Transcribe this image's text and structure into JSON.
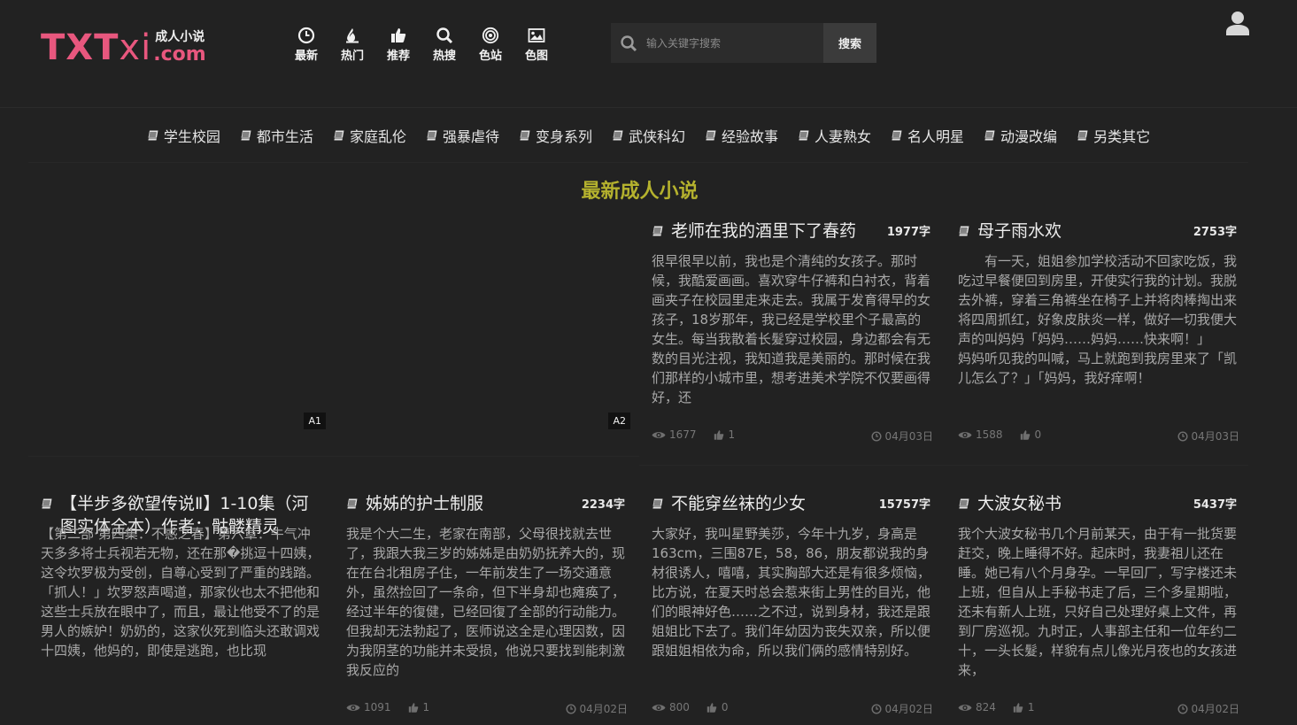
{
  "logo": {
    "part1": "TXT",
    "part2": "xi",
    "cn": "成人小说",
    "dotcom": ".com"
  },
  "topnav": [
    {
      "label": "最新",
      "icon": "clock-icon"
    },
    {
      "label": "热门",
      "icon": "flame-icon"
    },
    {
      "label": "推荐",
      "icon": "thumbs-up-icon"
    },
    {
      "label": "热搜",
      "icon": "search-icon"
    },
    {
      "label": "色站",
      "icon": "target-icon"
    },
    {
      "label": "色图",
      "icon": "image-icon"
    }
  ],
  "search": {
    "placeholder": "输入关键字搜索",
    "button": "搜索"
  },
  "categories": [
    "学生校园",
    "都市生活",
    "家庭乱伦",
    "强暴虐待",
    "变身系列",
    "武侠科幻",
    "经验故事",
    "人妻熟女",
    "名人明星",
    "动漫改编",
    "另类其它"
  ],
  "section_title": "最新成人小说",
  "ads": [
    "A1",
    "A2"
  ],
  "cards": [
    {
      "title": "老师在我的酒里下了春药",
      "words": "1977字",
      "excerpt": "很早很早以前，我也是个清纯的女孩子。那时候，我酷爱画画。喜欢穿牛仔裤和白衬衣，背着画夹子在校园里走来走去。我属于发育得早的女孩子，18岁那年，我已经是学校里个子最高的女生。每当我散着长髮穿过校园，身边都会有无数的目光注视，我知道我是美丽的。那时候在我们那样的小城市里，想考进美术学院不仅要画得好，还",
      "views": "1677",
      "likes": "1",
      "date": "04月03日"
    },
    {
      "title": "母子雨水欢",
      "words": "2753字",
      "excerpt": "　　有一天，姐姐参加学校活动不回家吃饭，我吃过早餐便回到房里，开使实行我的计划。我脱去外裤，穿着三角裤坐在椅子上并将肉棒掏出来将四周抓红，好象皮肤炎一样，做好一切我便大声的叫妈妈「妈妈……妈妈……快来啊！」　　妈妈听见我的叫喊，马上就跑到我房里来了「凯儿怎么了？」「妈妈，我好痒啊！",
      "views": "1588",
      "likes": "0",
      "date": "04月03日"
    },
    {
      "title": "【半步多欲望传说Ⅱ】1-10集（河图实体全本）作者：骷髅精灵",
      "words": "",
      "excerpt": "【第二部·第四集：不惑之春】第六章：牛气冲天多多将士兵视若无物，还在那�挑逗十四姨，这令坎罗极为受创，自尊心受到了严重的践踏。「抓人！」坎罗怒声喝道，那家伙也太不把他和这些士兵放在眼中了，而且，最让他受不了的是男人的嫉妒！奶奶的，这家伙死到临头还敢调戏十四姨，他妈的，即使是逃跑，也比现",
      "views": "",
      "likes": "",
      "date": ""
    },
    {
      "title": "姊姊的护士制服",
      "words": "2234字",
      "excerpt": "我是个大二生，老家在南部，父母很找就去世了，我跟大我三岁的姊姊是由奶奶抚养大的，现在在台北租房子住，一年前发生了一场交通意外，虽然捡回了一条命，但下半身却也瘫痪了，经过半年的復健，已经回復了全部的行动能力。但我却无法勃起了，医师说这全是心理因数，因为我阴茎的功能并未受损，他说只要找到能刺激我反应的",
      "views": "1091",
      "likes": "1",
      "date": "04月02日"
    },
    {
      "title": "不能穿丝袜的少女",
      "words": "15757字",
      "excerpt": "大家好，我叫星野美莎，今年十九岁，身高是163cm，三围87E，58，86，朋友都说我的身材很诱人，嘻嘻，其实胸部大还是有很多烦恼，比方说，在夏天时总会惹来街上男性的目光，他们的眼神好色……之不过，说到身材，我还是跟姐姐比下去了。我们年幼因为丧失双亲，所以便跟姐姐相依为命，所以我们俩的感情特别好。",
      "views": "800",
      "likes": "0",
      "date": "04月02日"
    },
    {
      "title": "大波女秘书",
      "words": "5437字",
      "excerpt": "我个大波女秘书几个月前某天，由于有一批货要赶交，晚上睡得不好。起床时，我妻祖儿还在睡。她已有八个月身孕。一早回厂，写字楼还未上班，但自从上手秘书走了后，三个多星期啦，还未有新人上班，只好自己处理好桌上文件，再到厂房巡视。九时正，人事部主任和一位年约二十，一头长髮，样貌有点儿像光月夜也的女孩进来，",
      "views": "824",
      "likes": "1",
      "date": "04月02日"
    }
  ]
}
